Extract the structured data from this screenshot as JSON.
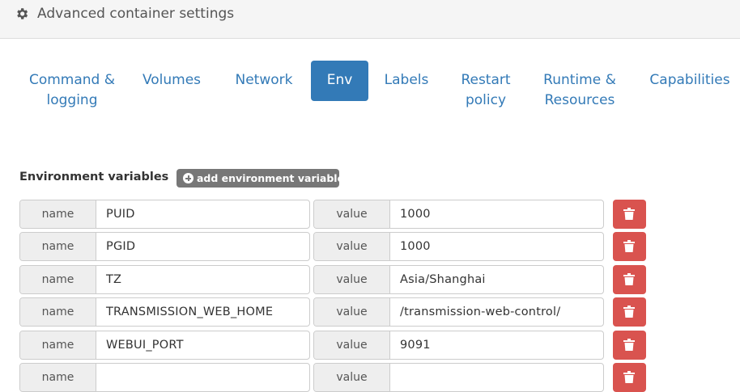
{
  "header": {
    "title": "Advanced container settings",
    "icon": "gear-icon"
  },
  "tabs": [
    {
      "label": "Command & logging",
      "active": false
    },
    {
      "label": "Volumes",
      "active": false
    },
    {
      "label": "Network",
      "active": false
    },
    {
      "label": "Env",
      "active": true
    },
    {
      "label": "Labels",
      "active": false
    },
    {
      "label": "Restart policy",
      "active": false
    },
    {
      "label": "Runtime & Resources",
      "active": false
    },
    {
      "label": "Capabilities",
      "active": false
    }
  ],
  "env": {
    "section_label": "Environment variables",
    "add_button_label": "add environment variable",
    "name_addon": "name",
    "value_addon": "value",
    "rows": [
      {
        "name": "PUID",
        "value": "1000"
      },
      {
        "name": "PGID",
        "value": "1000"
      },
      {
        "name": "TZ",
        "value": "Asia/Shanghai"
      },
      {
        "name": "TRANSMISSION_WEB_HOME",
        "value": "/transmission-web-control/"
      },
      {
        "name": "WEBUI_PORT",
        "value": "9091"
      },
      {
        "name": "",
        "value": ""
      }
    ]
  },
  "colors": {
    "primary": "#337ab7",
    "danger": "#d9534f",
    "button_default": "#777777",
    "header_bg": "#f5f5f5"
  }
}
